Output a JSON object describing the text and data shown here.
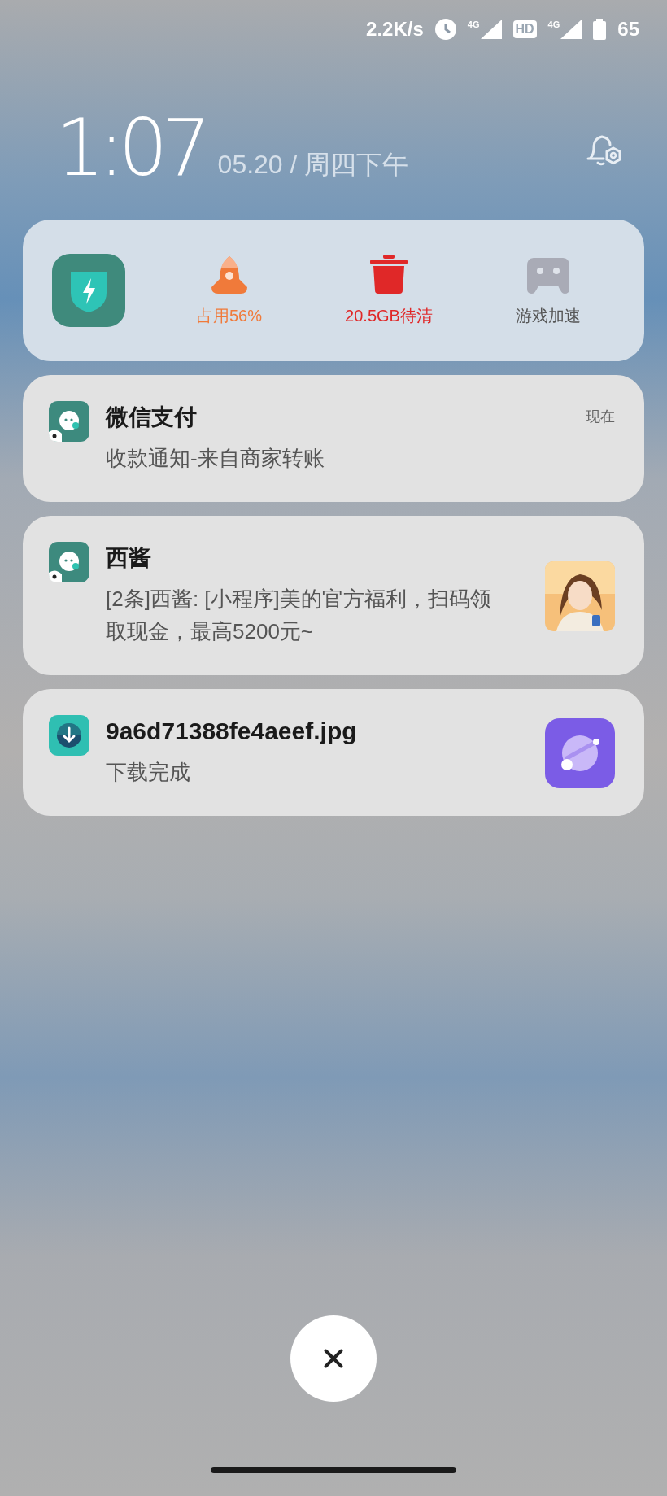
{
  "status_bar": {
    "speed": "2.2K/s",
    "network_1": "4G",
    "hd": "HD",
    "network_2": "4G",
    "battery": "65"
  },
  "clock": {
    "time": "1:07",
    "date": "05.20 / 周四下午"
  },
  "quick_panel": {
    "items": [
      {
        "kind": "rocket",
        "label": "占用56%",
        "color": "#f07a3a"
      },
      {
        "kind": "trash",
        "label": "20.5GB待清",
        "color": "#e02828"
      },
      {
        "kind": "gamepad",
        "label": "游戏加速",
        "color": "#555555"
      }
    ]
  },
  "notifications": [
    {
      "kind": "chat",
      "title": "微信支付",
      "text": "收款通知-来自商家转账",
      "time": "现在"
    },
    {
      "kind": "chat",
      "title": "西酱",
      "text": "[2条]西酱: [小程序]美的官方福利，扫码领取现金，最高5200元~"
    },
    {
      "kind": "download",
      "title": "9a6d71388fe4aeef.jpg",
      "text": "下载完成",
      "thumbnail": {
        "kind": "browser-app"
      }
    }
  ]
}
